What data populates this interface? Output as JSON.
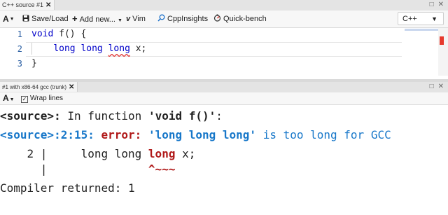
{
  "source_pane": {
    "tab_title": "C++ source #1",
    "tab_close": "✕",
    "window_controls": [
      "□",
      "✕"
    ],
    "toolbar": {
      "font_button": "A",
      "save_load_label": "Save/Load",
      "add_new_label": "Add new...",
      "vim_label": "Vim",
      "cppinsights_label": "CppInsights",
      "quickbench_label": "Quick-bench",
      "language": "C++"
    },
    "editor": {
      "line_numbers": [
        "1",
        "2",
        "3"
      ],
      "line1": {
        "kw": "void",
        "rest": " f() {"
      },
      "line2": {
        "indent": "    ",
        "kw": "long long",
        "space": " ",
        "err_word": "long",
        "rest": " x;"
      },
      "line3": {
        "text": "}"
      }
    }
  },
  "compiler_pane": {
    "tab_title": "#1 with x86-64 gcc (trunk)",
    "tab_close": "✕",
    "window_controls": [
      "□",
      "✕"
    ],
    "toolbar": {
      "font_button": "A",
      "wrap_lines_label": "Wrap lines",
      "wrap_lines_checked": true
    },
    "output": {
      "line1": {
        "src": "<source>:",
        "text": " In function ",
        "quoted": "'void f()'",
        "colon": ":"
      },
      "line2": {
        "loc": "<source>:2:15:",
        "sp": " ",
        "error": "error:",
        "sp2": " ",
        "quoted": "'long long long'",
        "text": " is too long for GCC"
      },
      "line3": {
        "prefix": "    2 |     long long ",
        "hl": "long",
        "rest": " x;"
      },
      "line4": {
        "prefix": "      |               ",
        "caret": "^~~~"
      },
      "line5": "Compiler returned: 1"
    }
  },
  "colors": {
    "keyword": "#0000c9",
    "error_red": "#b01818",
    "location_blue": "#1777c9"
  }
}
